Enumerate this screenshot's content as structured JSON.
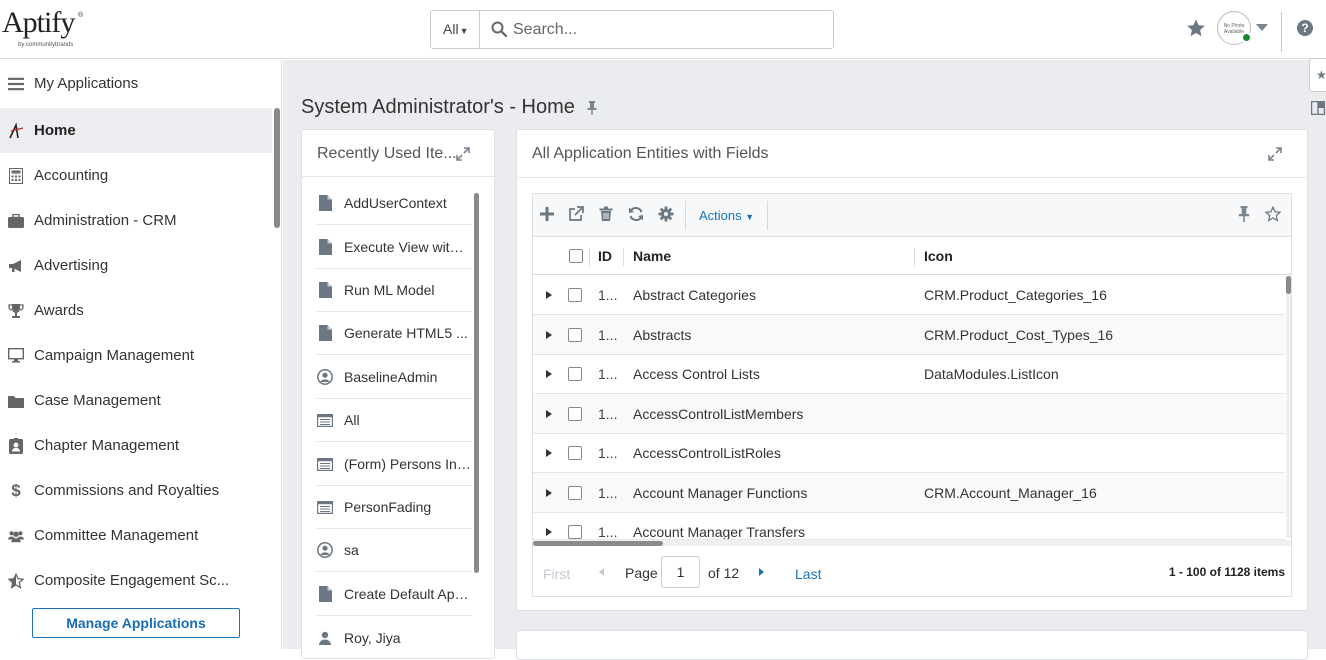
{
  "header": {
    "logo_text": "Aptify",
    "logo_sub": "by communitybrands",
    "search_scope": "All",
    "search_placeholder": "Search...",
    "avatar_text": "No Photo Available"
  },
  "sidebar": {
    "items": [
      {
        "label": "My Applications",
        "icon": "hamburger-icon"
      },
      {
        "label": "Home",
        "icon": "aptify-logo-icon",
        "active": true
      },
      {
        "label": "Accounting",
        "icon": "calculator-icon"
      },
      {
        "label": "Administration - CRM",
        "icon": "briefcase-icon"
      },
      {
        "label": "Advertising",
        "icon": "megaphone-icon"
      },
      {
        "label": "Awards",
        "icon": "trophy-icon"
      },
      {
        "label": "Campaign Management",
        "icon": "monitor-icon"
      },
      {
        "label": "Case Management",
        "icon": "folder-icon"
      },
      {
        "label": "Chapter Management",
        "icon": "id-badge-icon"
      },
      {
        "label": "Commissions and Royalties",
        "icon": "dollar-icon"
      },
      {
        "label": "Committee Management",
        "icon": "users-icon"
      },
      {
        "label": "Composite Engagement Sc...",
        "icon": "star-half-icon"
      }
    ],
    "manage_label": "Manage Applications"
  },
  "main": {
    "title": "System Administrator's - Home"
  },
  "recent": {
    "title": "Recently Used Ite...",
    "items": [
      {
        "label": "AddUserContext",
        "icon": "document-icon"
      },
      {
        "label": "Execute View with ...",
        "icon": "document-icon"
      },
      {
        "label": "Run ML Model",
        "icon": "document-icon"
      },
      {
        "label": "Generate HTML5 ...",
        "icon": "document-icon"
      },
      {
        "label": "BaselineAdmin",
        "icon": "user-circle-icon"
      },
      {
        "label": "All",
        "icon": "list-view-icon"
      },
      {
        "label": "(Form) Persons In ...",
        "icon": "list-view-icon"
      },
      {
        "label": "PersonFading",
        "icon": "list-view-icon"
      },
      {
        "label": "sa",
        "icon": "user-circle-icon"
      },
      {
        "label": "Create Default App...",
        "icon": "document-icon"
      },
      {
        "label": "Roy, Jiya",
        "icon": "person-icon"
      }
    ]
  },
  "entities": {
    "title": "All Application Entities with Fields",
    "actions_label": "Actions",
    "columns": {
      "id": "ID",
      "name": "Name",
      "icon": "Icon"
    },
    "rows": [
      {
        "id": "1...",
        "name": "Abstract Categories",
        "icon": "CRM.Product_Categories_16"
      },
      {
        "id": "1...",
        "name": "Abstracts",
        "icon": "CRM.Product_Cost_Types_16"
      },
      {
        "id": "1...",
        "name": "Access Control Lists",
        "icon": "DataModules.ListIcon"
      },
      {
        "id": "1...",
        "name": "AccessControlListMembers",
        "icon": ""
      },
      {
        "id": "1...",
        "name": "AccessControlListRoles",
        "icon": ""
      },
      {
        "id": "1...",
        "name": "Account Manager Functions",
        "icon": "CRM.Account_Manager_16"
      },
      {
        "id": "1...",
        "name": "Account Manager Transfers",
        "icon": ""
      }
    ],
    "pager": {
      "first": "First",
      "page_label": "Page",
      "page_value": "1",
      "of_label": "of 12",
      "last": "Last",
      "count": "1 - 100 of 1128 items"
    }
  },
  "colors": {
    "accent": "#1a73b5",
    "status_online": "#1a8a2e",
    "main_bg": "#eaecef"
  }
}
